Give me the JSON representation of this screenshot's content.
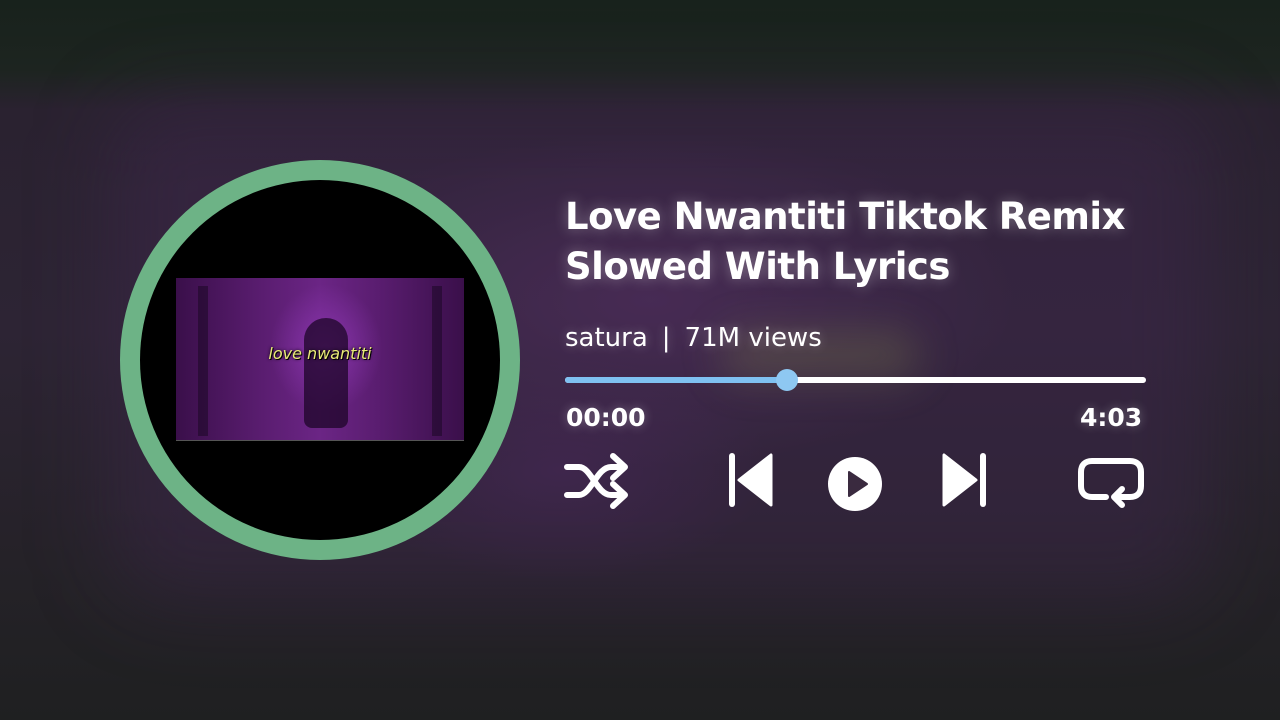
{
  "track": {
    "title": "Love Nwantiti Tiktok Remix Slowed With Lyrics",
    "artist": "satura",
    "separator": "|",
    "views": "71M views"
  },
  "album_art": {
    "caption": "love nwantiti",
    "ring_color": "#6db386"
  },
  "playback": {
    "current_time": "00:00",
    "total_time": "4:03",
    "progress_fraction": 0.382,
    "progress_color": "#7fc1f1"
  },
  "controls": {
    "icons": [
      "shuffle-icon",
      "previous-icon",
      "play-icon",
      "next-icon",
      "repeat-icon"
    ]
  }
}
